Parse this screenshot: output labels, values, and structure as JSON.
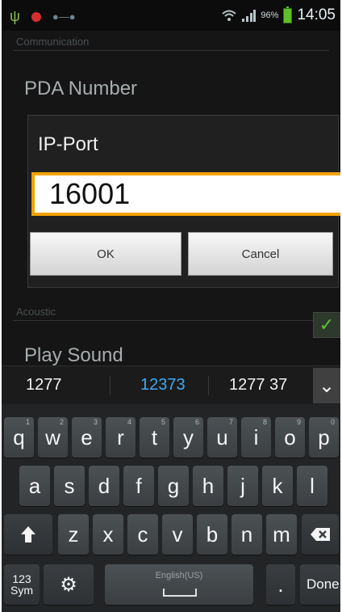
{
  "status_bar": {
    "time": "14:05",
    "battery_percent": "96%",
    "icons": [
      "usb-icon",
      "record-icon",
      "voicemail-icon",
      "wifi-icon",
      "signal-icon",
      "battery-icon"
    ]
  },
  "settings": {
    "section_communication": "Communication",
    "pda_number_label": "PDA Number",
    "section_acoustic": "Acoustic",
    "play_sound_label": "Play Sound",
    "play_sound_checked": true
  },
  "dialog": {
    "title": "IP-Port",
    "input_value": "16001",
    "ok_label": "OK",
    "cancel_label": "Cancel"
  },
  "suggestions": [
    "1277",
    "12373",
    "1277 37"
  ],
  "keyboard": {
    "row1": [
      {
        "label": "q",
        "sub": "1"
      },
      {
        "label": "w",
        "sub": "2"
      },
      {
        "label": "e",
        "sub": "3"
      },
      {
        "label": "r",
        "sub": "4"
      },
      {
        "label": "t",
        "sub": "5"
      },
      {
        "label": "y",
        "sub": "6"
      },
      {
        "label": "u",
        "sub": "7"
      },
      {
        "label": "i",
        "sub": "8"
      },
      {
        "label": "o",
        "sub": "9"
      },
      {
        "label": "p",
        "sub": "0"
      }
    ],
    "row2": [
      "a",
      "s",
      "d",
      "f",
      "g",
      "h",
      "j",
      "k",
      "l"
    ],
    "row3": [
      "z",
      "x",
      "c",
      "v",
      "b",
      "n",
      "m"
    ],
    "sym_label_line1": "123",
    "sym_label_line2": "Sym",
    "space_label": "English(US)",
    "period_label": ".",
    "done_label": "Done"
  },
  "colors": {
    "input_border": "#f2a200",
    "suggestion_highlight": "#3fa9f5",
    "checkbox_check": "#5dc13a"
  }
}
